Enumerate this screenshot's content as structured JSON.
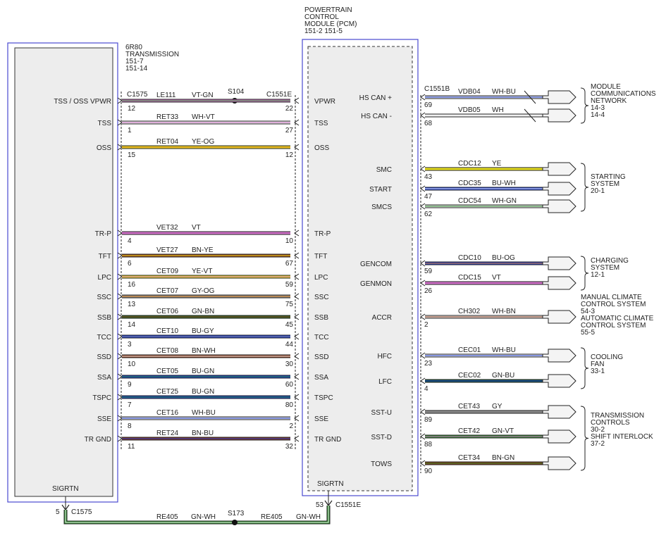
{
  "trans": {
    "name": "6R80",
    "sub": "TRANSMISSION",
    "ref1": "151-7",
    "ref2": "151-14",
    "connector": "C1575",
    "sigrtn": "SIGRTN",
    "sig_pin": "5",
    "sig_conn": "C1575"
  },
  "pcm": {
    "l1": "POWERTRAIN",
    "l2": "CONTROL",
    "l3": "MODULE (PCM)",
    "l4": "151-2  151-5",
    "connector": "C1551E",
    "right_connector": "C1551B",
    "sigrtn": "SIGRTN",
    "sig_pin": "53",
    "sig_conn": "C1551E"
  },
  "splices": {
    "top": "S104",
    "bottom": "S173"
  },
  "ground": {
    "circuit_left": "RE405",
    "color_left": "GN-WH",
    "circuit_right": "RE405",
    "color_right": "GN-WH"
  },
  "left_wires": [
    {
      "tl": "TSS / OSS VPWR",
      "tp": "12",
      "circuit": "LE111",
      "color": "VT-GN",
      "pp": "22",
      "pl": "VPWR",
      "c1": "#d070c8",
      "c2": "#3a9a3a",
      "splice": true
    },
    {
      "tl": "TSS",
      "tp": "1",
      "circuit": "RET33",
      "color": "WH-VT",
      "pp": "27",
      "pl": "TSS",
      "c1": "#f0f0f0",
      "c2": "#d070c8"
    },
    {
      "tl": "OSS",
      "tp": "15",
      "circuit": "RET04",
      "color": "YE-OG",
      "pp": "12",
      "pl": "OSS",
      "c1": "#e8e020",
      "c2": "#e88a20"
    },
    {
      "tl": "TR-P",
      "tp": "4",
      "circuit": "VET32",
      "color": "VT",
      "pp": "10",
      "pl": "TR-P",
      "c1": "#d070c8",
      "c2": "#d070c8"
    },
    {
      "tl": "TFT",
      "tp": "6",
      "circuit": "VET27",
      "color": "BN-YE",
      "pp": "67",
      "pl": "TFT",
      "c1": "#8b3a1a",
      "c2": "#e8e020"
    },
    {
      "tl": "LPC",
      "tp": "16",
      "circuit": "CET09",
      "color": "YE-VT",
      "pp": "59",
      "pl": "LPC",
      "c1": "#e8e020",
      "c2": "#d070c8"
    },
    {
      "tl": "SSC",
      "tp": "13",
      "circuit": "CET07",
      "color": "GY-OG",
      "pp": "75",
      "pl": "SSC",
      "c1": "#8a8a8a",
      "c2": "#e88a20"
    },
    {
      "tl": "SSB",
      "tp": "14",
      "circuit": "CET06",
      "color": "GN-BN",
      "pp": "45",
      "pl": "SSB",
      "c1": "#2a6a2a",
      "c2": "#8b3a1a"
    },
    {
      "tl": "TCC",
      "tp": "3",
      "circuit": "CET10",
      "color": "BU-GY",
      "pp": "44",
      "pl": "TCC",
      "c1": "#1a3ad0",
      "c2": "#8a8a8a"
    },
    {
      "tl": "SSD",
      "tp": "10",
      "circuit": "CET08",
      "color": "BN-WH",
      "pp": "30",
      "pl": "SSD",
      "c1": "#8b3a1a",
      "c2": "#f0f0f0"
    },
    {
      "tl": "SSA",
      "tp": "9",
      "circuit": "CET05",
      "color": "BU-GN",
      "pp": "60",
      "pl": "SSA",
      "c1": "#1a3ad0",
      "c2": "#2a8a2a"
    },
    {
      "tl": "TSPC",
      "tp": "7",
      "circuit": "CET25",
      "color": "BU-GN",
      "pp": "80",
      "pl": "TSPC",
      "c1": "#1a3ad0",
      "c2": "#2a8a2a"
    },
    {
      "tl": "SSE",
      "tp": "8",
      "circuit": "CET16",
      "color": "WH-BU",
      "pp": "2",
      "pl": "SSE",
      "c1": "#f0f0f0",
      "c2": "#1a3ad0"
    },
    {
      "tl": "TR GND",
      "tp": "11",
      "circuit": "RET24",
      "color": "BN-BU",
      "pp": "32",
      "pl": "TR GND",
      "c1": "#8b3a1a",
      "c2": "#1a3ad0"
    }
  ],
  "right_wires": [
    {
      "label": "HS CAN +",
      "pin": "69",
      "circuit": "VDB04",
      "color": "WH-BU",
      "c1": "#f0f0f0",
      "c2": "#1a3ad0",
      "twist": true
    },
    {
      "label": "HS CAN -",
      "pin": "68",
      "circuit": "VDB05",
      "color": "WH",
      "c1": "#f0f0f0",
      "c2": "#f0f0f0",
      "twist": true
    },
    {
      "label": "SMC",
      "pin": "43",
      "circuit": "CDC12",
      "color": "YE",
      "c1": "#e8e020",
      "c2": "#e8e020"
    },
    {
      "label": "START",
      "pin": "47",
      "circuit": "CDC35",
      "color": "BU-WH",
      "c1": "#1a3ad0",
      "c2": "#f0f0f0"
    },
    {
      "label": "SMCS",
      "pin": "62",
      "circuit": "CDC54",
      "color": "WH-GN",
      "c1": "#f0f0f0",
      "c2": "#2a8a2a"
    },
    {
      "label": "GENCOM",
      "pin": "59",
      "circuit": "CDC10",
      "color": "BU-OG",
      "c1": "#1a3ad0",
      "c2": "#e88a20"
    },
    {
      "label": "GENMON",
      "pin": "26",
      "circuit": "CDC15",
      "color": "VT",
      "c1": "#d070c8",
      "c2": "#d070c8"
    },
    {
      "label": "ACCR",
      "pin": "2",
      "circuit": "CH302",
      "color": "WH-BN",
      "c1": "#f0f0f0",
      "c2": "#8b3a1a"
    },
    {
      "label": "HFC",
      "pin": "23",
      "circuit": "CEC01",
      "color": "WH-BU",
      "c1": "#f0f0f0",
      "c2": "#1a3ad0"
    },
    {
      "label": "LFC",
      "pin": "4",
      "circuit": "CEC02",
      "color": "GN-BU",
      "c1": "#1a5a3a",
      "c2": "#1a3ad0"
    },
    {
      "label": "SST-U",
      "pin": "89",
      "circuit": "CET43",
      "color": "GY",
      "c1": "#8a8a8a",
      "c2": "#8a8a8a"
    },
    {
      "label": "SST-D",
      "pin": "88",
      "circuit": "CET42",
      "color": "GN-VT",
      "c1": "#2a8a2a",
      "c2": "#d070c8"
    },
    {
      "label": "TOWS",
      "pin": "90",
      "circuit": "CET34",
      "color": "BN-GN",
      "c1": "#8b3a1a",
      "c2": "#2a8a2a"
    }
  ],
  "destinations": [
    {
      "l1": "MODULE",
      "l2": "COMMUNICATIONS",
      "l3": "NETWORK",
      "l4": "14-3",
      "l5": "14-4"
    },
    {
      "l1": "STARTING",
      "l2": "SYSTEM",
      "l3": "20-1"
    },
    {
      "l1": "CHARGING",
      "l2": "SYSTEM",
      "l3": "12-1"
    },
    {
      "l1": "MANUAL CLIMATE",
      "l2": "CONTROL SYSTEM",
      "l3": "54-3",
      "l4": "AUTOMATIC CLIMATE",
      "l5": "CONTROL SYSTEM",
      "l6": "55-5"
    },
    {
      "l1": "COOLING",
      "l2": "FAN",
      "l3": "33-1"
    },
    {
      "l1": "TRANSMISSION",
      "l2": "CONTROLS",
      "l3": "30-2",
      "l4": "SHIFT INTERLOCK",
      "l5": "37-2"
    }
  ]
}
